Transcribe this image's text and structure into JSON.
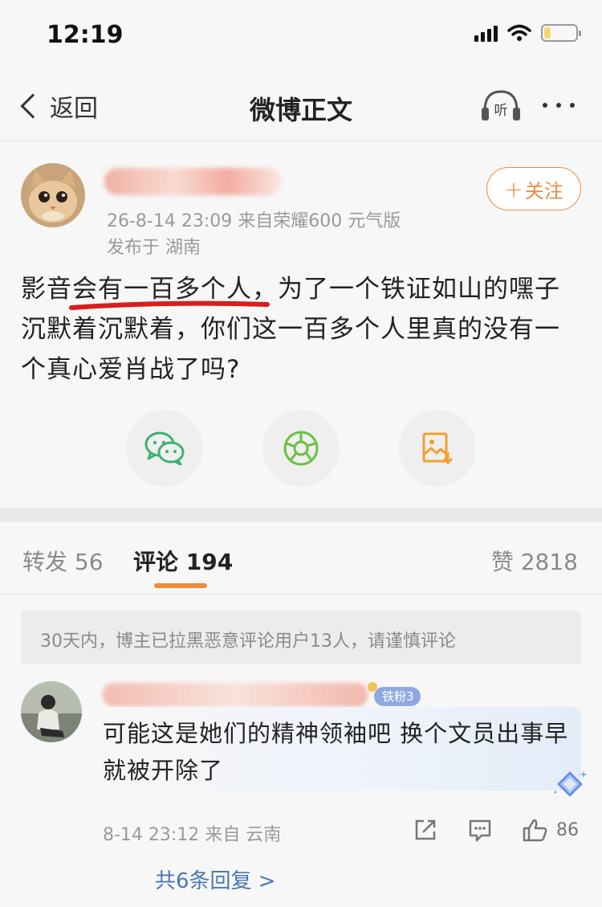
{
  "status_bar": {
    "time": "12:19",
    "battery_level": 0.2
  },
  "nav": {
    "back_label": "返回",
    "title": "微博正文",
    "listen_label": "听"
  },
  "post": {
    "meta_time_source": "26-8-14 23:09  来自荣耀600 元气版",
    "meta_location": "发布于 湖南",
    "follow_label": "关注",
    "content": "影音会有一百多个人，为了一个铁证如山的嘿子沉默着沉默着，你们这一百多个人里真的没有一个真心爱肖战了吗?",
    "share_icons": [
      "wechat-icon",
      "moments-icon",
      "save-image-icon"
    ]
  },
  "tabs": {
    "repost": "转发 56",
    "comment": "评论 194",
    "like": "赞 2818"
  },
  "notice": "30天内，博主已拉黑恶意评论用户13人，请谨慎评论",
  "comment": {
    "badge": "铁粉3",
    "text": "可能这是她们的精神领袖吧 换个文员出事早就被开除了",
    "meta": "8-14 23:12  来自 云南",
    "likes": "86",
    "replies": "共6条回复 >"
  },
  "colors": {
    "accent": "#f08a3d",
    "link": "#4a78b5",
    "wechat": "#3cb371",
    "moments": "#6bc043",
    "save": "#f0a030"
  }
}
